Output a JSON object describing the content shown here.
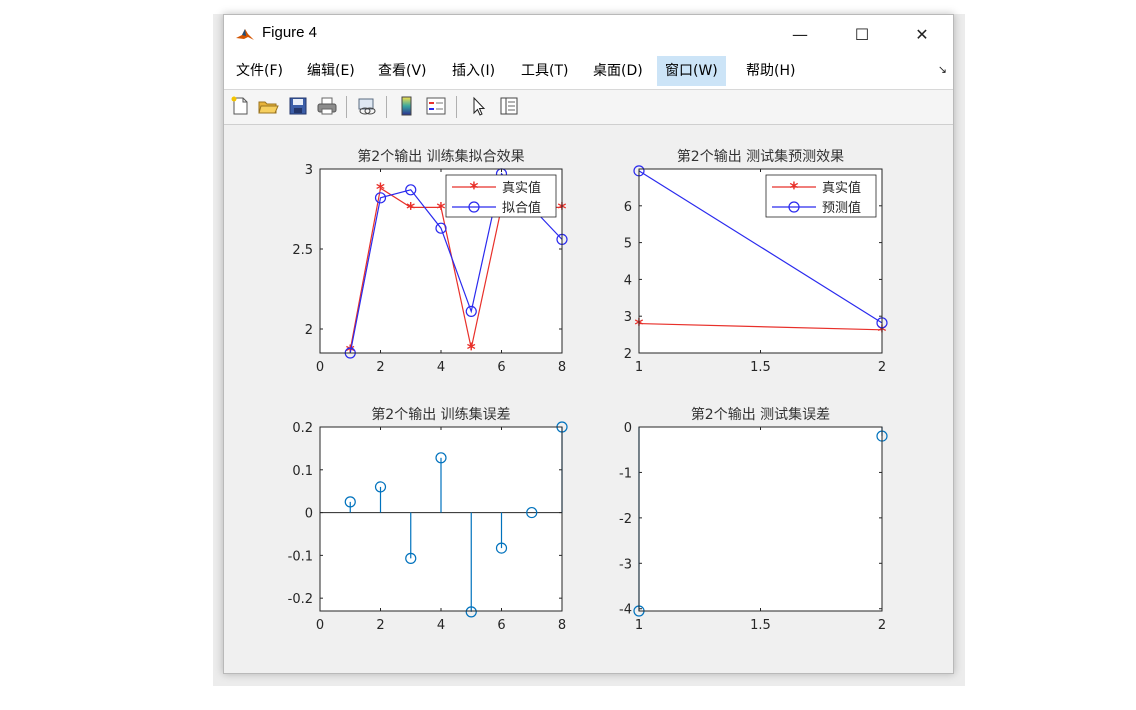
{
  "window": {
    "title": "Figure 4",
    "minimize": "—",
    "maximize": "☐",
    "close": "✕"
  },
  "menu": [
    {
      "label": "文件(F)",
      "key": "file"
    },
    {
      "label": "编辑(E)",
      "key": "edit"
    },
    {
      "label": "查看(V)",
      "key": "view"
    },
    {
      "label": "插入(I)",
      "key": "insert"
    },
    {
      "label": "工具(T)",
      "key": "tools"
    },
    {
      "label": "桌面(D)",
      "key": "desktop"
    },
    {
      "label": "窗口(W)",
      "key": "window",
      "active": true
    },
    {
      "label": "帮助(H)",
      "key": "help"
    }
  ],
  "menu_dock_arrow": "↘",
  "toolbar_icons": [
    "new-figure-icon",
    "open-file-icon",
    "save-icon",
    "print-icon",
    "link-plot-icon",
    "colorbar-icon",
    "legend-icon",
    "pointer-icon",
    "property-inspector-icon"
  ],
  "colors": {
    "red": "#e8302a",
    "blue": "#2a2aee",
    "stem": "#0072bd"
  },
  "chart_data": [
    {
      "type": "line",
      "title": "第2个输出 训练集拟合效果",
      "x": [
        1,
        2,
        3,
        4,
        5,
        6,
        7,
        8
      ],
      "xlim": [
        0,
        8
      ],
      "ylim": [
        1.85,
        3
      ],
      "xticks": [
        0,
        2,
        4,
        6,
        8
      ],
      "yticks": [
        2,
        2.5,
        3
      ],
      "series": [
        {
          "name": "真实值",
          "marker": "*",
          "color": "#e8302a",
          "values": [
            1.87,
            2.88,
            2.76,
            2.76,
            1.88,
            2.76,
            2.76,
            2.76
          ]
        },
        {
          "name": "拟合值",
          "marker": "o",
          "color": "#2a2aee",
          "values": [
            1.85,
            2.82,
            2.87,
            2.63,
            2.11,
            2.97,
            2.76,
            2.56
          ]
        }
      ],
      "legend": "top-right"
    },
    {
      "type": "line",
      "title": "第2个输出 测试集预测效果",
      "x": [
        1,
        2
      ],
      "xlim": [
        1,
        2
      ],
      "ylim": [
        2,
        7
      ],
      "xticks": [
        1,
        1.5,
        2
      ],
      "yticks": [
        2,
        3,
        4,
        5,
        6
      ],
      "series": [
        {
          "name": "真实值",
          "marker": "*",
          "color": "#e8302a",
          "values": [
            2.8,
            2.63
          ]
        },
        {
          "name": "预测值",
          "marker": "o",
          "color": "#2a2aee",
          "values": [
            6.95,
            2.82
          ]
        }
      ],
      "legend": "top-right"
    },
    {
      "type": "stem",
      "title": "第2个输出 训练集误差",
      "x": [
        1,
        2,
        3,
        4,
        5,
        6,
        7,
        8
      ],
      "xlim": [
        0,
        8
      ],
      "ylim": [
        -0.23,
        0.2
      ],
      "xticks": [
        0,
        2,
        4,
        6,
        8
      ],
      "yticks": [
        -0.2,
        -0.1,
        0,
        0.1,
        0.2
      ],
      "values": [
        0.025,
        0.06,
        -0.107,
        0.128,
        -0.232,
        -0.083,
        0,
        0.2
      ]
    },
    {
      "type": "stem",
      "title": "第2个输出 测试集误差",
      "x": [
        1,
        2
      ],
      "xlim": [
        1,
        2
      ],
      "ylim": [
        -4.05,
        0
      ],
      "xticks": [
        1,
        1.5,
        2
      ],
      "yticks": [
        -4,
        -3,
        -2,
        -1,
        0
      ],
      "values": [
        -4.05,
        -0.2
      ]
    }
  ]
}
